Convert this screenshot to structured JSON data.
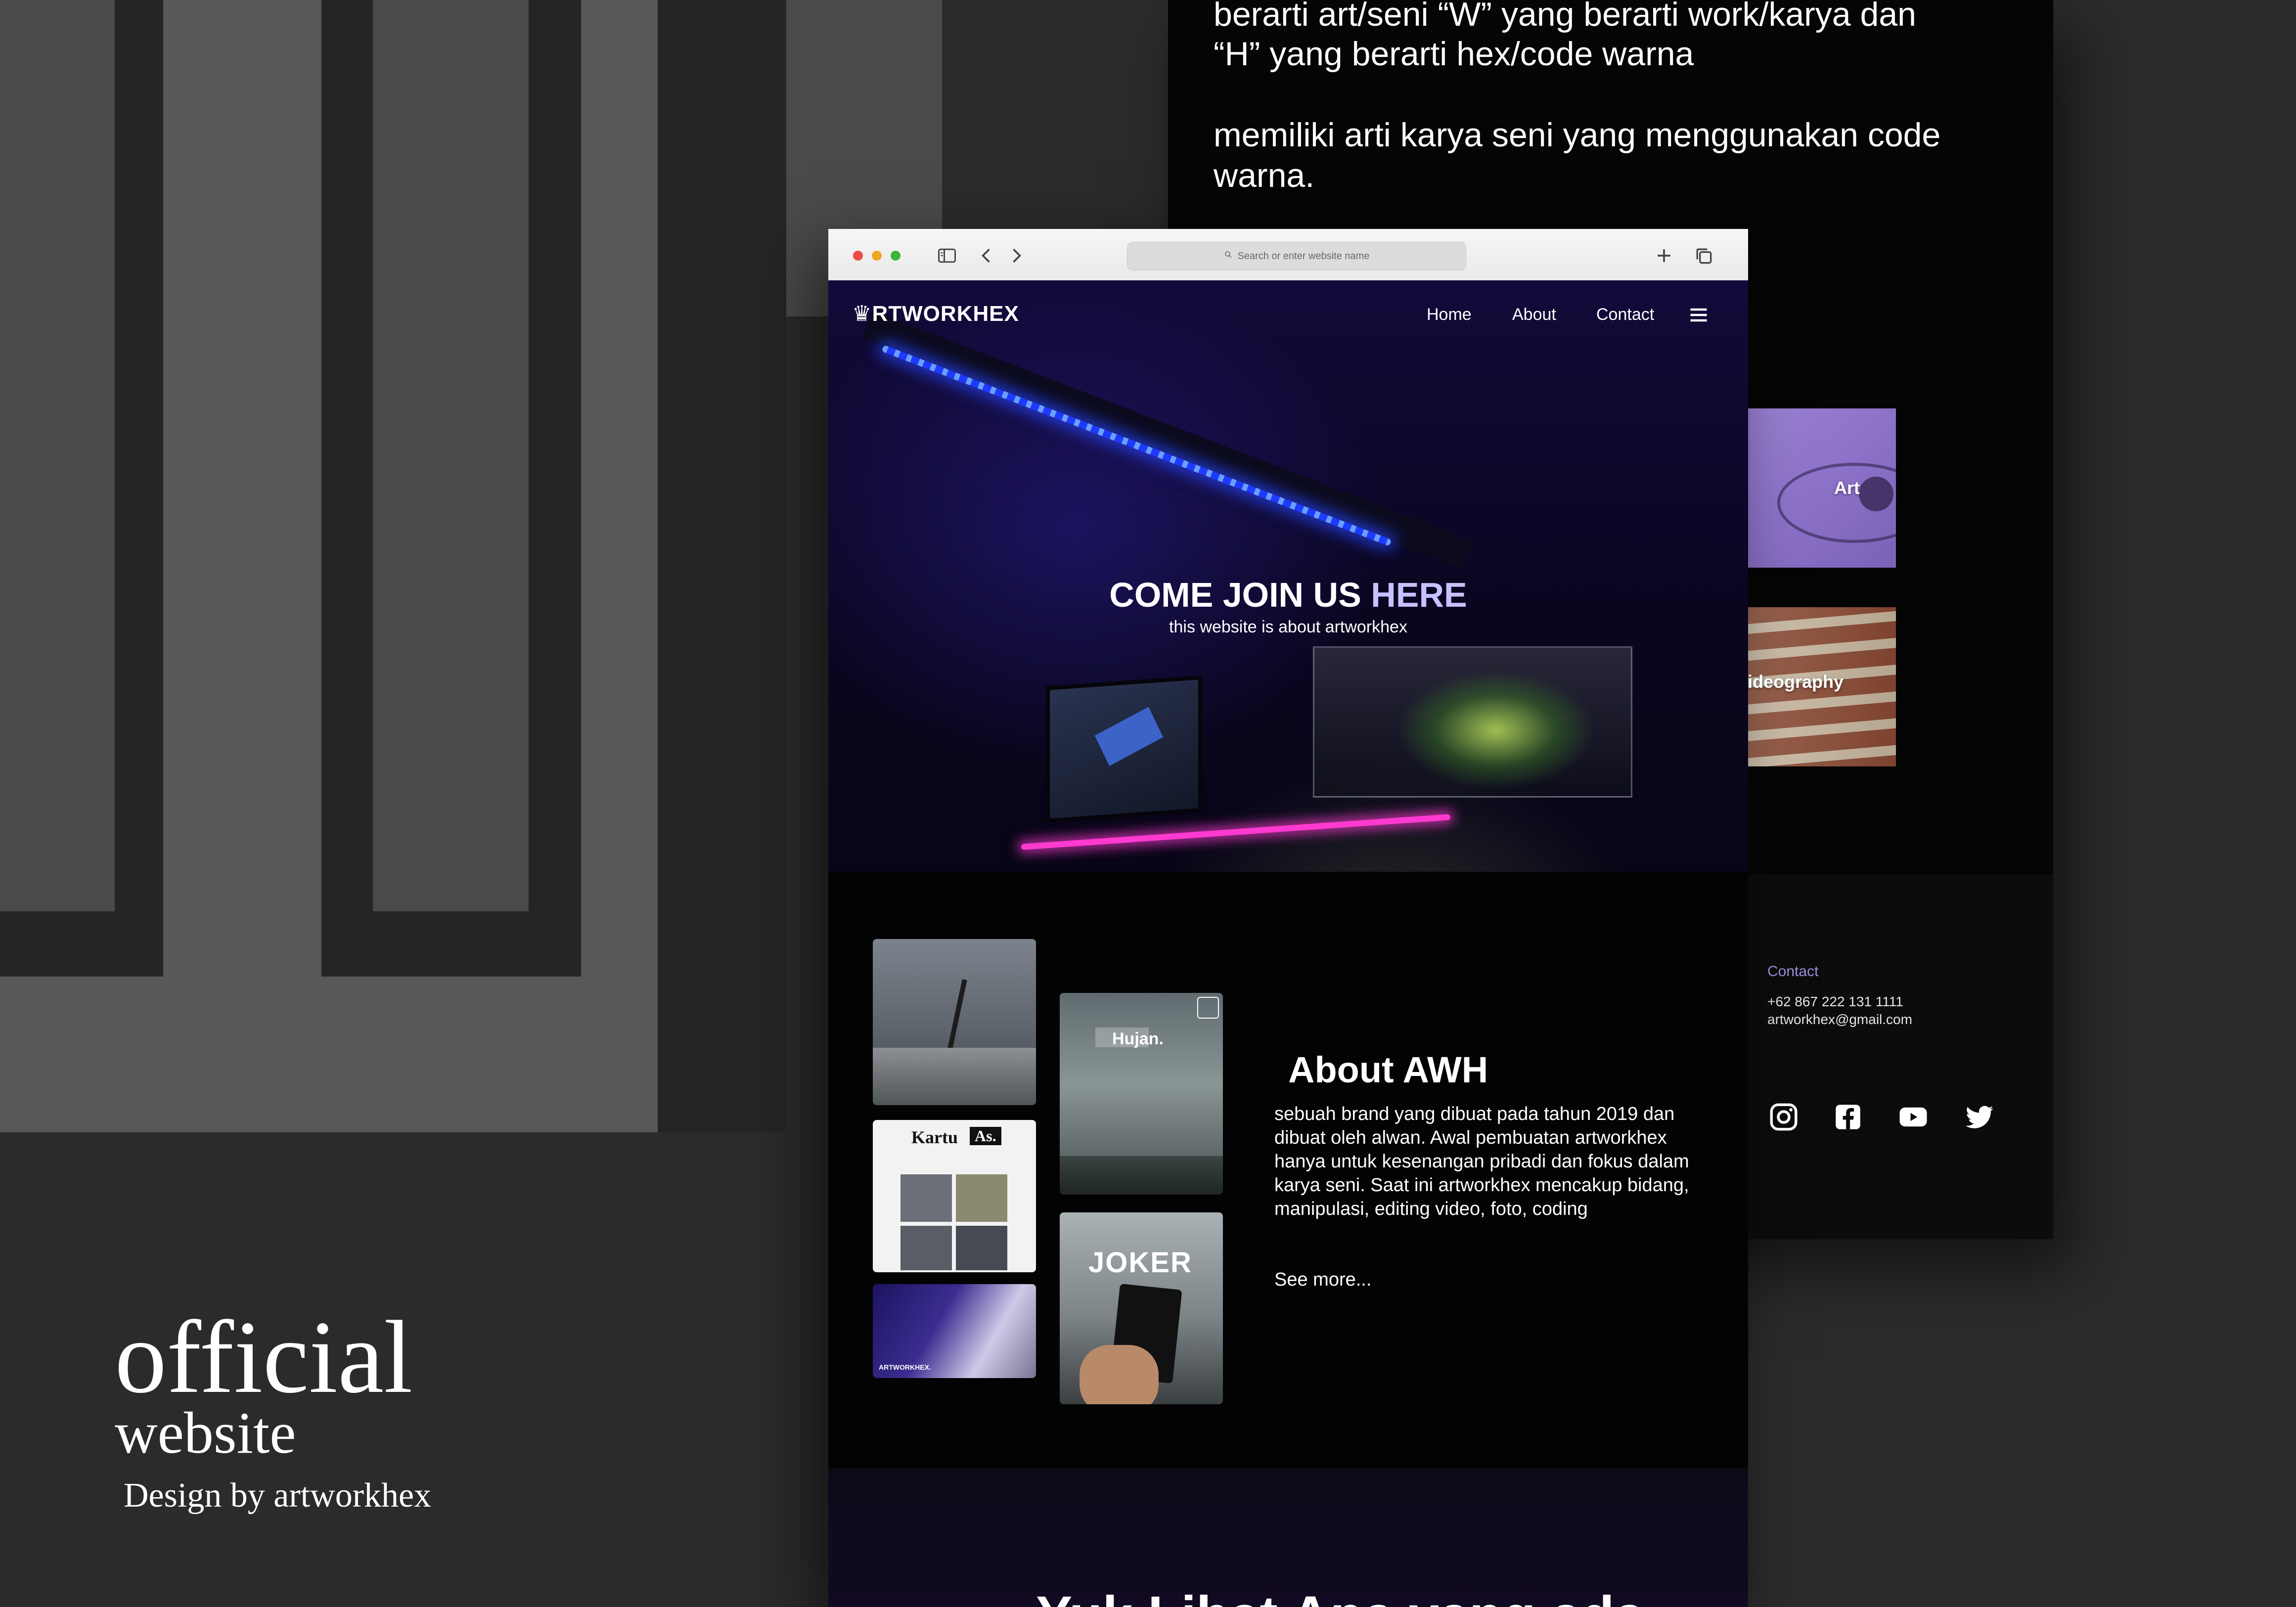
{
  "showcase": {
    "line1": "official",
    "line2": "website",
    "credit": "Design by artworkhex"
  },
  "back_page": {
    "text_line1": "berarti art/seni “W” yang berarti work/karya  dan",
    "text_line2": "“H” yang berarti hex/code warna",
    "text_para2_line1": "memiliki arti karya seni yang menggunakan code",
    "text_para2_line2": "warna.",
    "tiles": [
      {
        "label": "Art"
      },
      {
        "label": "ideography"
      }
    ],
    "contact": {
      "title": "Contact",
      "phone": "+62 867 222 131 1111",
      "email": "artworkhex@gmail.com"
    },
    "social_icons": [
      "instagram-icon",
      "facebook-icon",
      "youtube-icon",
      "twitter-icon"
    ]
  },
  "browser": {
    "address_placeholder": "Search or enter website name",
    "nav": {
      "logo": "♛RTWORKHEX",
      "items": [
        "Home",
        "About",
        "Contact"
      ]
    },
    "hero": {
      "title_main": "COME JOIN US ",
      "title_accent": "HERE",
      "subtitle": "this website is about artworkhex"
    },
    "gallery": {
      "hujan_title": "Hujan.",
      "kartu_title": "Kartu",
      "kartu_badge": "As.",
      "joker_title": "JOKER",
      "artwork_label": "ARTWORKHEX."
    },
    "about": {
      "title": "About AWH",
      "body": "sebuah brand yang dibuat pada tahun 2019 dan dibuat oleh alwan. Awal pembuatan artworkhex hanya untuk kesenangan pribadi dan fokus dalam karya seni. Saat ini artworkhex mencakup bidang, manipulasi, editing video, foto, coding",
      "see_more": "See more..."
    },
    "bottom_heading": "Yuk Lihat Apa yang ada"
  },
  "colors": {
    "accent": "#c7c2ff",
    "contact_title": "#9d8fe0",
    "neon_pink": "#ff3ad0",
    "led_blue": "#1f3aff"
  }
}
